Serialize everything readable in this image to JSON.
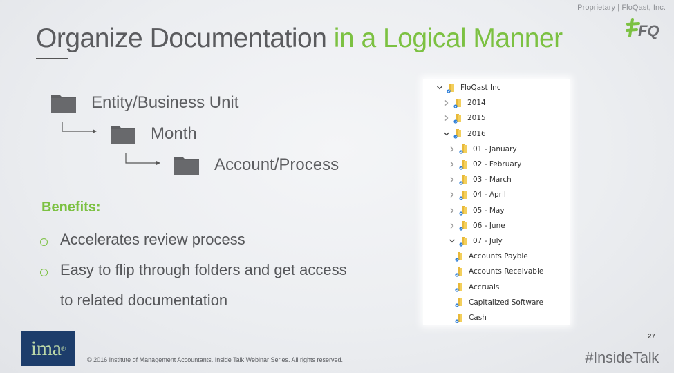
{
  "header": {
    "proprietary": "Proprietary | FloQast, Inc.",
    "logo": "FloQast #FQ logo",
    "title_main": "Organize Documentation",
    "title_accent": "in a Logical Manner"
  },
  "hierarchy": [
    {
      "label": "Entity/Business Unit",
      "icon": "folder-icon"
    },
    {
      "label": "Month",
      "icon": "folder-icon"
    },
    {
      "label": "Account/Process",
      "icon": "folder-icon"
    }
  ],
  "benefits": {
    "title": "Benefits:",
    "items": [
      "Accelerates review process",
      "Easy to flip through folders and get access to related documentation"
    ]
  },
  "explorer": {
    "tree": [
      {
        "label": "FloQast Inc",
        "level": 0,
        "expander": "expanded"
      },
      {
        "label": "2014",
        "level": 1,
        "expander": "collapsed"
      },
      {
        "label": "2015",
        "level": 1,
        "expander": "collapsed"
      },
      {
        "label": "2016",
        "level": 1,
        "expander": "expanded"
      },
      {
        "label": "01 - January",
        "level": 2,
        "expander": "collapsed"
      },
      {
        "label": "02 - February",
        "level": 2,
        "expander": "collapsed"
      },
      {
        "label": "03 - March",
        "level": 2,
        "expander": "collapsed"
      },
      {
        "label": "04 - April",
        "level": 2,
        "expander": "collapsed"
      },
      {
        "label": "05 - May",
        "level": 2,
        "expander": "collapsed"
      },
      {
        "label": "06 - June",
        "level": 2,
        "expander": "collapsed"
      },
      {
        "label": "07 - July",
        "level": 2,
        "expander": "expanded"
      },
      {
        "label": "Accounts Payble",
        "level": 3,
        "expander": "none"
      },
      {
        "label": "Accounts Receivable",
        "level": 3,
        "expander": "none"
      },
      {
        "label": "Accruals",
        "level": 3,
        "expander": "none"
      },
      {
        "label": "Capitalized Software",
        "level": 3,
        "expander": "none"
      },
      {
        "label": "Cash",
        "level": 3,
        "expander": "none"
      }
    ]
  },
  "footer": {
    "ima_logo_text": "ima",
    "ima_logo_mark": "®",
    "copyright": "© 2016 Institute of Management Accountants. Inside Talk Webinar Series. All rights reserved.",
    "page_number": "27",
    "hashtag": "#InsideTalk"
  },
  "colors": {
    "accent_green": "#7cc142",
    "title_gray": "#5a5b5e",
    "ima_navy": "#1d3d6b",
    "folder_gray": "#5f6063",
    "explorer_folder_yellow": "#f3cf5c",
    "explorer_sync_blue": "#2f7fd8"
  }
}
